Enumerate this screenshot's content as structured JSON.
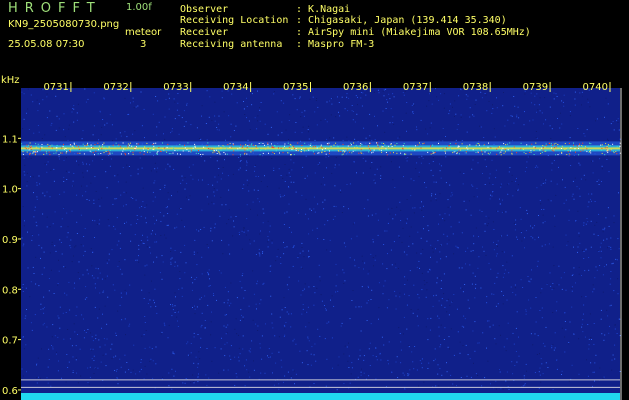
{
  "header": {
    "app_title": "HROFFT",
    "version": "1.00f",
    "filename": "KN9_2505080730.png",
    "meteor_label": "meteor",
    "datetime": "25.05.08 07:30",
    "meteor_count": "3",
    "info": [
      {
        "label": "Observer",
        "value": "K.Nagai"
      },
      {
        "label": "Receiving Location",
        "value": "Chigasaki, Japan (139.414 35.340)"
      },
      {
        "label": "Receiver",
        "value": "AirSpy mini (Miakejima VOR 108.65MHz)"
      },
      {
        "label": "Receiving antenna",
        "value": "Maspro FM-3"
      }
    ]
  },
  "colors": {
    "background": "#000000",
    "text": "#ffff66",
    "title": "#9fe07a",
    "spectrum": "#10208a"
  },
  "chart_data": {
    "type": "heatmap",
    "ylabel": "kHz",
    "ylim": [
      0.58,
      1.2
    ],
    "yticks": [
      "1.1",
      "1.0",
      "0.9",
      "0.8",
      "0.7",
      "0.6"
    ],
    "ytick_values": [
      1.1,
      1.0,
      0.9,
      0.8,
      0.7,
      0.6
    ],
    "xlim": [
      0,
      10
    ],
    "xticks": [
      "0731",
      "0732",
      "0733",
      "0734",
      "0735",
      "0736",
      "0737",
      "0738",
      "0739",
      "0740"
    ],
    "xtick_values": [
      1,
      2,
      3,
      4,
      5,
      6,
      7,
      8,
      9,
      10
    ],
    "carrier_frequency": 1.08,
    "reference_lines": [
      0.62,
      0.605
    ]
  }
}
